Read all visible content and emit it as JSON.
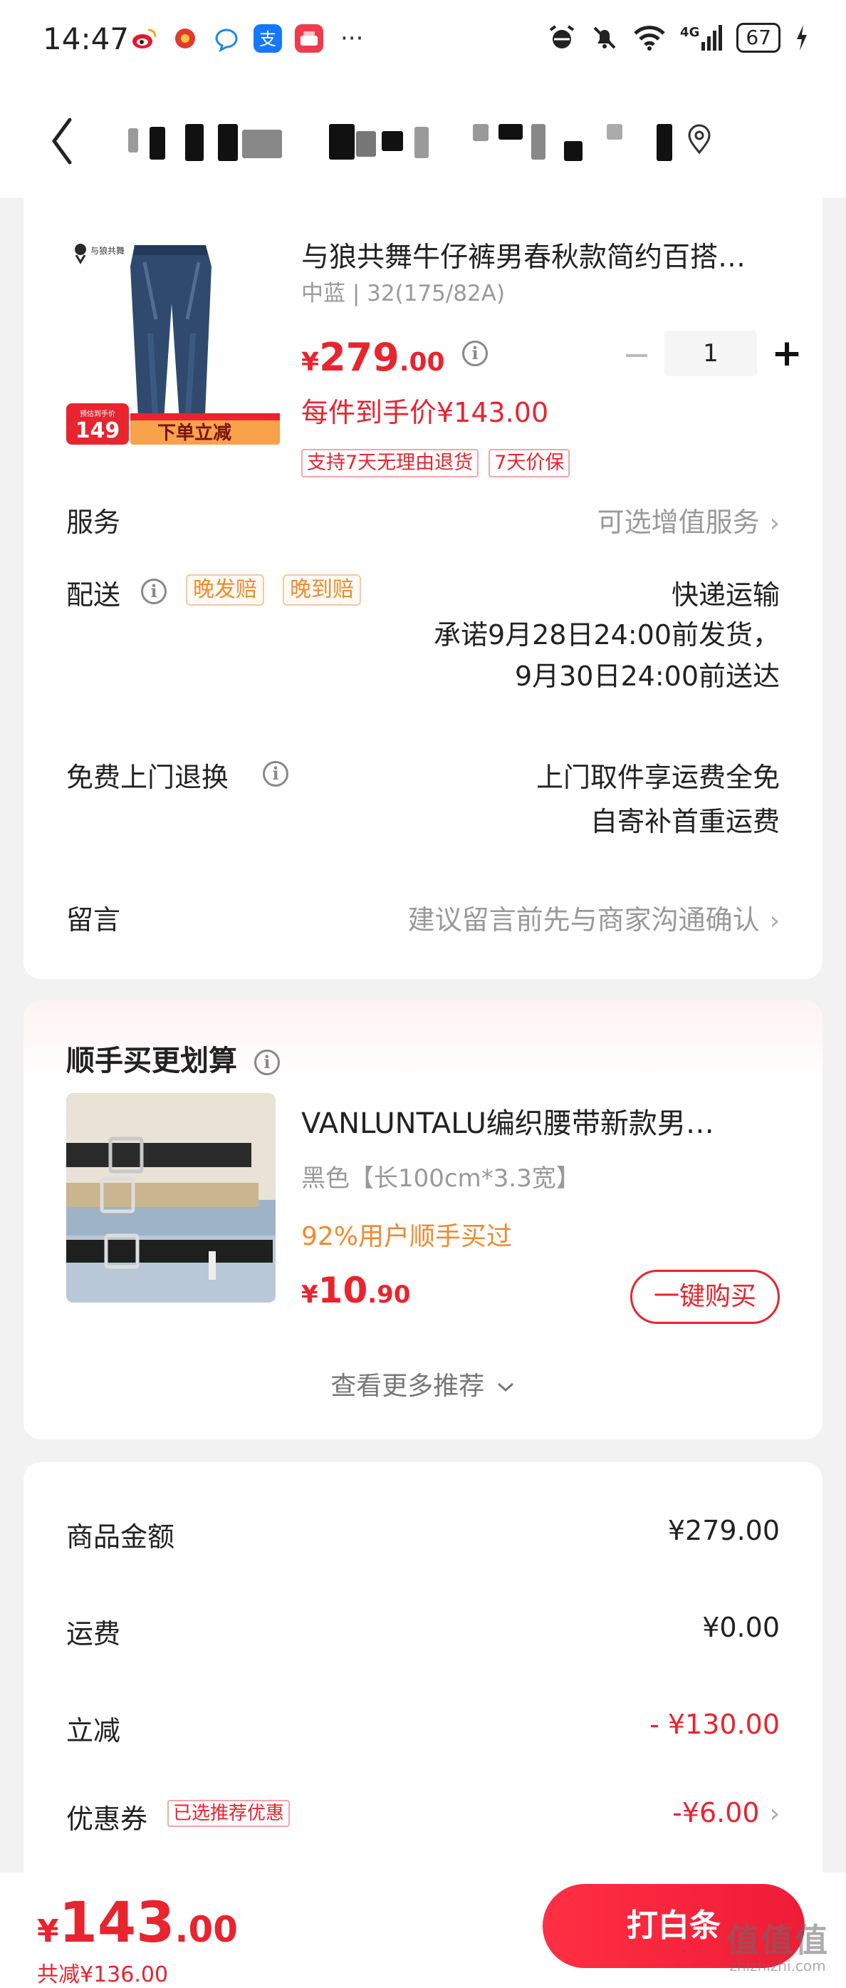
{
  "status_bar": {
    "time": "14:47",
    "network": "4G",
    "battery": "67",
    "more": "···",
    "app_icons": [
      "weibo-app-icon",
      "app-badge-icon",
      "qq-app-icon",
      "alipay-app-icon",
      "store-app-icon"
    ]
  },
  "header": {
    "address_redacted": true
  },
  "product": {
    "title": "与狼共舞牛仔裤男春秋款简约百搭…",
    "spec": "中蓝 | 32(175/82A)",
    "price_yen": "¥",
    "price_int": "279",
    "price_dec": ".00",
    "quantity": "1",
    "unit_price": "每件到手价¥143.00",
    "tags": [
      "支持7天无理由退货",
      "7天价保"
    ],
    "image_badge_price": "149",
    "image_badge_text": "下单立减",
    "image_badge_caption": "预估到手价",
    "image_brand": "与狼共舞"
  },
  "service": {
    "label": "服务",
    "value": "可选增值服务"
  },
  "delivery": {
    "label": "配送",
    "tags": [
      "晚发赔",
      "晚到赔"
    ],
    "method": "快递运输",
    "promise_line1": "承诺9月28日24:00前发货，",
    "promise_line2": "9月30日24:00前送达"
  },
  "return_service": {
    "label": "免费上门退换",
    "line1": "上门取件享运费全免",
    "line2": "自寄补首重运费"
  },
  "message": {
    "label": "留言",
    "placeholder": "建议留言前先与商家沟通确认"
  },
  "addon": {
    "section_title": "顺手买更划算",
    "name": "VANLUNTALU编织腰带新款男…",
    "spec": "黑色【长100cm*3.3宽】",
    "rate": "92%用户顺手买过",
    "price_yen": "¥",
    "price_int": "10",
    "price_dec": ".90",
    "buy_label": "一键购买",
    "more_label": "查看更多推荐"
  },
  "summary": {
    "rows": [
      {
        "label": "商品金额",
        "value": "¥279.00"
      },
      {
        "label": "运费",
        "value": "¥0.00"
      },
      {
        "label": "立减",
        "value": "- ¥130.00"
      },
      {
        "label": "优惠券",
        "value": "-¥6.00"
      }
    ],
    "coupon_tag": "已选推荐优惠"
  },
  "bottom": {
    "total_yen": "¥",
    "total_int": "143",
    "total_dec": ".00",
    "saving": "共减¥136.00",
    "pay_label": "打白条",
    "watermark_mark": "值值值",
    "watermark_url": "zhizhizhi.com"
  },
  "colors": {
    "accent": "#e8242f",
    "orange": "#ef8a2e",
    "background": "#f2f2f2"
  }
}
